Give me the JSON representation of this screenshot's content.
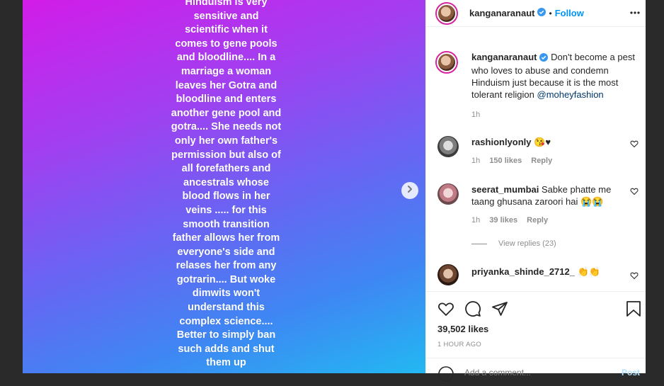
{
  "story": {
    "text": "Hinduism is very\nsensitive and\nscientific when it\ncomes to gene pools\nand bloodline.... In a\nmarriage a woman\nleaves her Gotra and\nbloodline and enters\nanother gene pool and\ngotra.... She needs not\nonly her own father's\npermission but also of\nall forefathers and\nancestrals whose\nblood flows in her\nveins ..... for this\nsmooth transition\nfather allows her from\neveryone's side and\nrelases her from any\ngotrarin.... But woke\ndimwits won't\nunderstand this\ncomplex science....\nBetter to simply ban\nsuch adds and shut\nthem up"
  },
  "header": {
    "username": "kanganaranaut",
    "separator": "•",
    "follow_label": "Follow"
  },
  "caption": {
    "username": "kanganaranaut",
    "text": "Don't become a pest who loves to abuse and condemn Hinduism just because it is the most tolerant religion",
    "mention": "@moheyfashion",
    "time": "1h"
  },
  "comments": [
    {
      "username": "rashionlyonly",
      "text": "😘♥",
      "time": "1h",
      "likes": "150 likes",
      "reply": "Reply"
    },
    {
      "username": "seerat_mumbai",
      "text": "Sabke phatte me taang ghusana zaroori hai 😭😭",
      "time": "1h",
      "likes": "39 likes",
      "reply": "Reply"
    },
    {
      "username": "priyanka_shinde_2712_",
      "text": "👏👏"
    }
  ],
  "view_replies": "View replies (23)",
  "actions": {
    "likes": "39,502 likes",
    "time": "1 HOUR AGO"
  },
  "add_comment": {
    "placeholder": "Add a comment...",
    "post_label": "Post"
  },
  "colors": {
    "accent": "#0095f6",
    "gradient_top": "#d21ce8",
    "gradient_bottom": "#22b8f2"
  }
}
